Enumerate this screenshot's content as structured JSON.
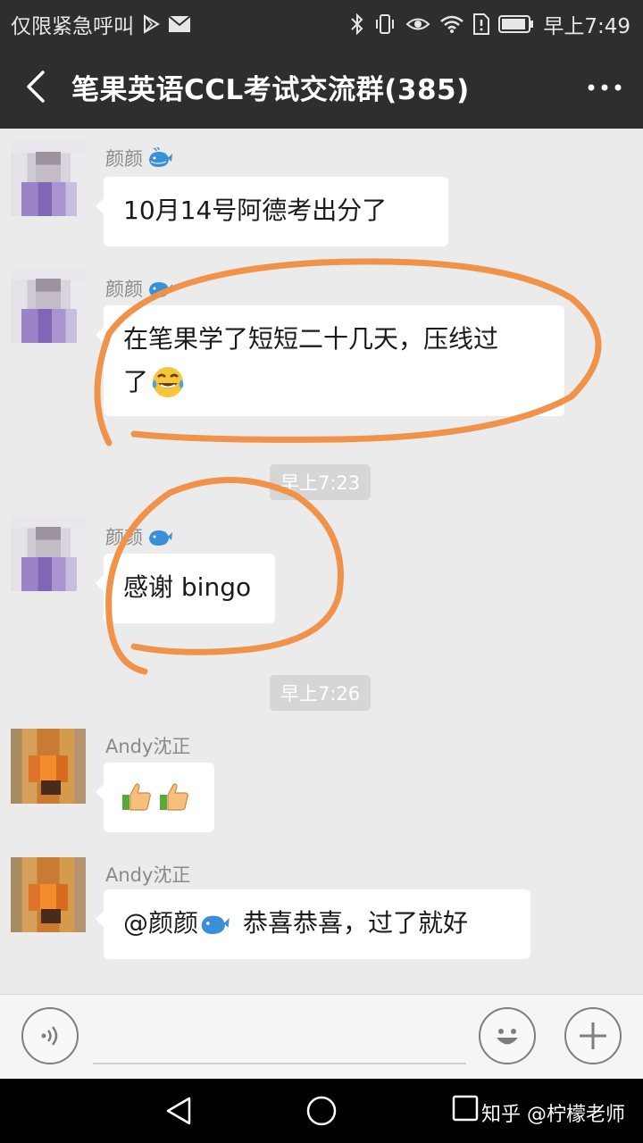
{
  "status_bar": {
    "carrier": "仅限紧急呼叫",
    "time": "早上7:49"
  },
  "header": {
    "title": "笔果英语CCL考试交流群(385)"
  },
  "messages": [
    {
      "sender": "颜颜",
      "text": "10月14号阿德考出分了"
    },
    {
      "sender": "颜颜",
      "text_line1": "在笔果学了短短二十几天，压线过",
      "text_line2": "了"
    },
    {
      "sender": "颜颜",
      "text": "感谢 bingo"
    },
    {
      "sender": "Andy沈正"
    },
    {
      "sender": "Andy沈正",
      "mention": "@颜颜",
      "text": "恭喜恭喜，过了就好"
    }
  ],
  "timestamps": [
    "早上7:23",
    "早上7:26"
  ],
  "watermark": "知乎 @柠檬老师",
  "colors": {
    "bar_bg": "#2e2e2e",
    "chat_bg": "#ebebeb",
    "bubble_bg": "#ffffff",
    "annotation": "#f0924a",
    "timestamp_bg": "#d6d6d6"
  },
  "icons": [
    "back-arrow-icon",
    "more-dots-icon",
    "voice-icon",
    "emoji-icon",
    "plus-icon",
    "whale-emoji",
    "laugh-cry-emoji",
    "thumbs-up-emoji"
  ]
}
